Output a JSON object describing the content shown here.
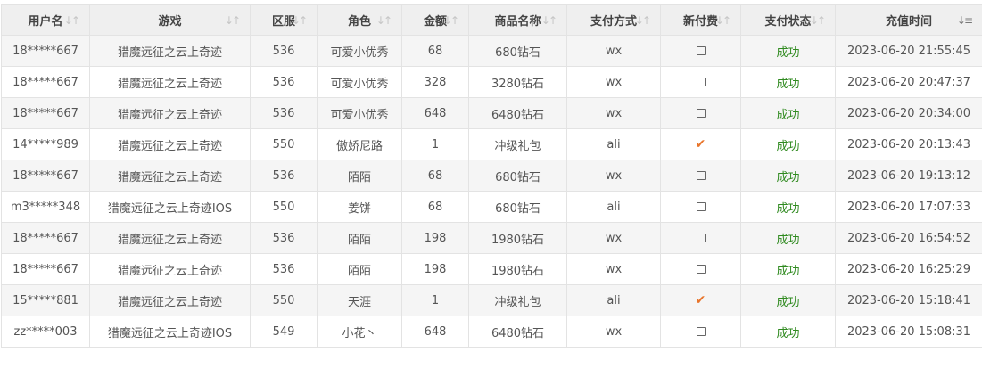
{
  "table": {
    "columns": [
      {
        "key": "user",
        "label": "用户名",
        "width": 99,
        "sort": "none"
      },
      {
        "key": "game",
        "label": "游戏",
        "width": 180,
        "sort": "none"
      },
      {
        "key": "server",
        "label": "区服",
        "width": 75,
        "sort": "none"
      },
      {
        "key": "role",
        "label": "角色",
        "width": 95,
        "sort": "none"
      },
      {
        "key": "amount",
        "label": "金额",
        "width": 75,
        "sort": "none"
      },
      {
        "key": "product",
        "label": "商品名称",
        "width": 110,
        "sort": "none"
      },
      {
        "key": "pay_method",
        "label": "支付方式",
        "width": 105,
        "sort": "none"
      },
      {
        "key": "new_pay",
        "label": "新付费",
        "width": 90,
        "sort": "none"
      },
      {
        "key": "status",
        "label": "支付状态",
        "width": 106,
        "sort": "none"
      },
      {
        "key": "time",
        "label": "充值时间",
        "width": 165,
        "sort": "desc"
      }
    ],
    "sort_icon": "sort-arrows-icon",
    "colors": {
      "header_bg": "#efefef",
      "row_odd_bg": "#f5f5f5",
      "row_even_bg": "#ffffff",
      "border": "#e3e3e3",
      "success": "#2f8a1f",
      "check": "#e8742a"
    },
    "rows": [
      {
        "user": "18*****667",
        "game": "猎魔远征之云上奇迹",
        "server": "536",
        "role": "可爱小优秀",
        "amount": "68",
        "product": "680钻石",
        "pay_method": "wx",
        "new_pay": false,
        "status": "成功",
        "time": "2023-06-20 21:55:45"
      },
      {
        "user": "18*****667",
        "game": "猎魔远征之云上奇迹",
        "server": "536",
        "role": "可爱小优秀",
        "amount": "328",
        "product": "3280钻石",
        "pay_method": "wx",
        "new_pay": false,
        "status": "成功",
        "time": "2023-06-20 20:47:37"
      },
      {
        "user": "18*****667",
        "game": "猎魔远征之云上奇迹",
        "server": "536",
        "role": "可爱小优秀",
        "amount": "648",
        "product": "6480钻石",
        "pay_method": "wx",
        "new_pay": false,
        "status": "成功",
        "time": "2023-06-20 20:34:00"
      },
      {
        "user": "14*****989",
        "game": "猎魔远征之云上奇迹",
        "server": "550",
        "role": "傲娇尼路",
        "amount": "1",
        "product": "冲级礼包",
        "pay_method": "ali",
        "new_pay": true,
        "status": "成功",
        "time": "2023-06-20 20:13:43"
      },
      {
        "user": "18*****667",
        "game": "猎魔远征之云上奇迹",
        "server": "536",
        "role": "陌陌",
        "amount": "68",
        "product": "680钻石",
        "pay_method": "wx",
        "new_pay": false,
        "status": "成功",
        "time": "2023-06-20 19:13:12"
      },
      {
        "user": "m3*****348",
        "game": "猎魔远征之云上奇迹IOS",
        "server": "550",
        "role": "姜饼",
        "amount": "68",
        "product": "680钻石",
        "pay_method": "ali",
        "new_pay": false,
        "status": "成功",
        "time": "2023-06-20 17:07:33"
      },
      {
        "user": "18*****667",
        "game": "猎魔远征之云上奇迹",
        "server": "536",
        "role": "陌陌",
        "amount": "198",
        "product": "1980钻石",
        "pay_method": "wx",
        "new_pay": false,
        "status": "成功",
        "time": "2023-06-20 16:54:52"
      },
      {
        "user": "18*****667",
        "game": "猎魔远征之云上奇迹",
        "server": "536",
        "role": "陌陌",
        "amount": "198",
        "product": "1980钻石",
        "pay_method": "wx",
        "new_pay": false,
        "status": "成功",
        "time": "2023-06-20 16:25:29"
      },
      {
        "user": "15*****881",
        "game": "猎魔远征之云上奇迹",
        "server": "550",
        "role": "天涯",
        "amount": "1",
        "product": "冲级礼包",
        "pay_method": "ali",
        "new_pay": true,
        "status": "成功",
        "time": "2023-06-20 15:18:41"
      },
      {
        "user": "zz*****003",
        "game": "猎魔远征之云上奇迹IOS",
        "server": "549",
        "role": "小花丶",
        "amount": "648",
        "product": "6480钻石",
        "pay_method": "wx",
        "new_pay": false,
        "status": "成功",
        "time": "2023-06-20 15:08:31"
      }
    ]
  }
}
